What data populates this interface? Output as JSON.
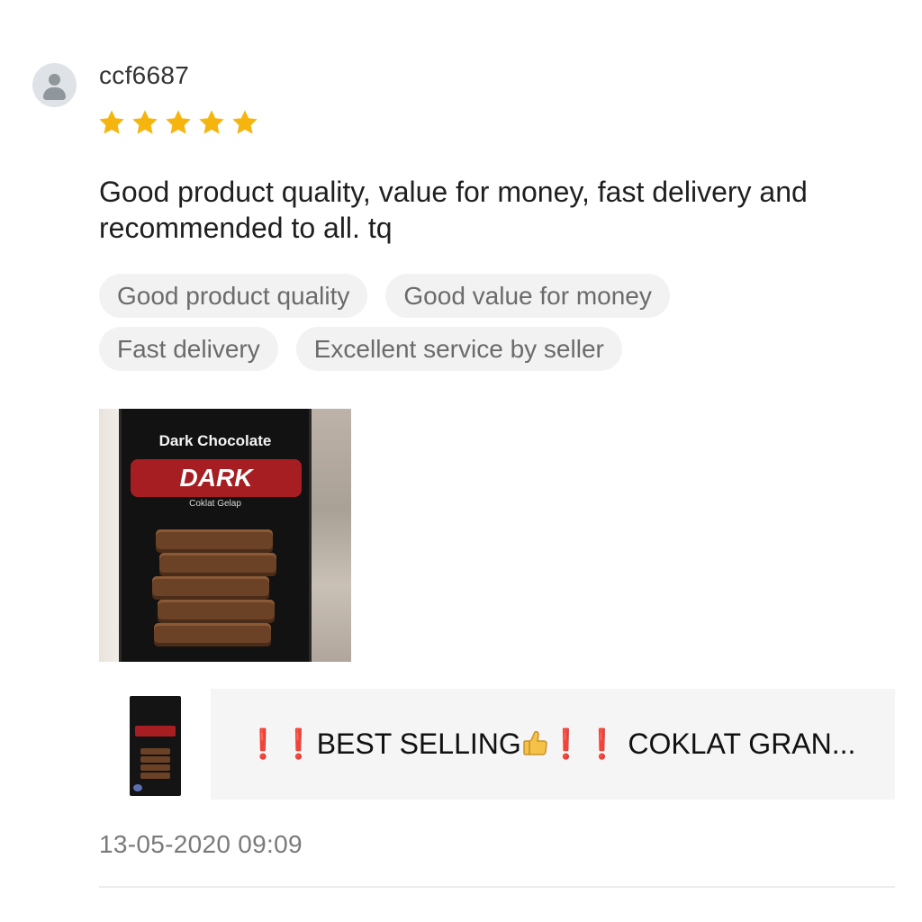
{
  "review": {
    "username": "ccf6687",
    "rating": 5,
    "max_rating": 5,
    "star_color": "#f6b50e",
    "text": "Good product quality, value for money, fast delivery and recommended to all. tq",
    "tags": [
      "Good product quality",
      "Good value for money",
      "Fast delivery",
      "Excellent service by seller"
    ],
    "date": "13-05-2020 09:09"
  },
  "photo": {
    "box_label": "Dark Chocolate",
    "band_label": "DARK",
    "sub_label": "Coklat Gelap"
  },
  "product": {
    "title_text": "BEST SELLING",
    "title_suffix": "COKLAT GRAN...",
    "thumb_label": "DARK"
  },
  "icons": {
    "avatar": "user-avatar-icon",
    "star": "star-icon",
    "emphasis": "double-exclamation-icon",
    "thumbs": "thumbs-up-icon"
  }
}
